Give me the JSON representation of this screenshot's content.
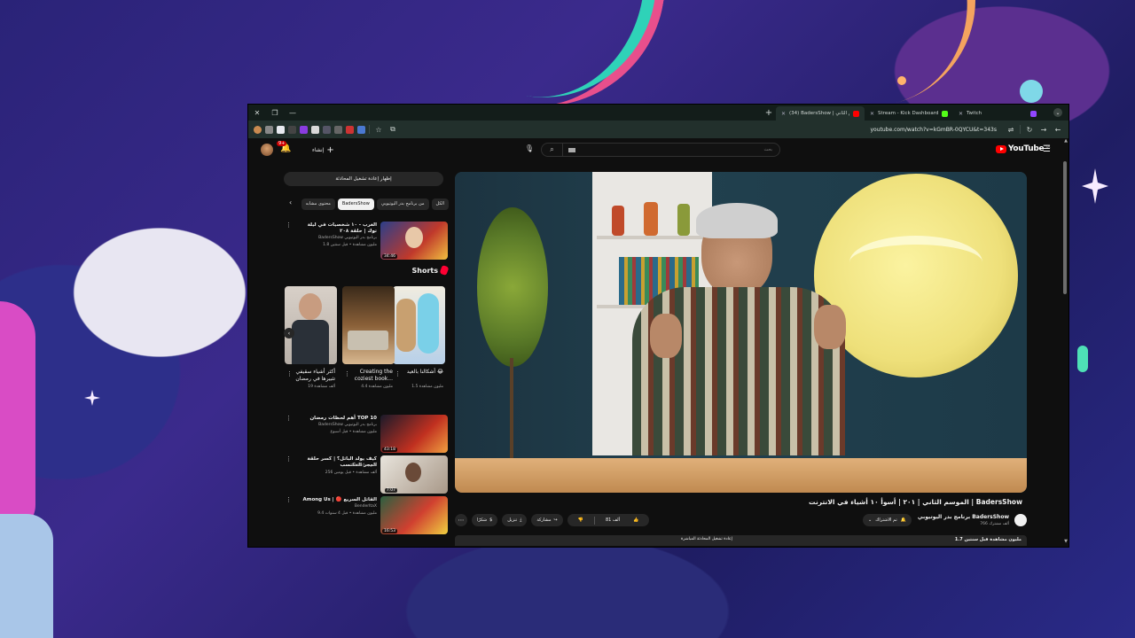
{
  "browser": {
    "tabs": [
      {
        "title": "(34) BadersShow | الموسم الثاني",
        "active": true,
        "favicon": "youtube",
        "color": "#ff0000"
      },
      {
        "title": "Stream - Kick Dashboard",
        "active": false,
        "favicon": "kick",
        "color": "#53fc18"
      },
      {
        "title": "Twitch",
        "active": false,
        "favicon": "twitch",
        "color": "#9146ff"
      }
    ],
    "url": "youtube.com/watch?v=kGmBR-0QYCU&t=343s"
  },
  "yt_header": {
    "notification_count": "9+",
    "create_label": "إنشاء",
    "search_placeholder": "بحث",
    "logo_text": "YouTube",
    "logo_region": "SA"
  },
  "sidebar": {
    "replay_chat_label": "إظهار إعادة تشغيل المحادثة",
    "chips": [
      {
        "label": "الكل",
        "selected": false
      },
      {
        "label": "من برنامج بدر اليوتيوبي",
        "selected": false
      },
      {
        "label": "BadersShow",
        "selected": true
      },
      {
        "label": "محتوى مشابه",
        "selected": false
      }
    ],
    "top_video": {
      "title": "الغرب - ١٠ شخصيات في ليلة توك | حلقة ٢٠٨",
      "channel": "BadersShow برنامج بدر اليوتيوبي",
      "meta": "1.8 مليون مشاهدة • قبل سنتين",
      "duration": "34:46"
    },
    "shorts_label": "Shorts",
    "shorts": [
      {
        "title": "أشكالنا بالعيد 😂",
        "views": "1.5 مليون مشاهدة"
      },
      {
        "title": "Creating the coziest book...",
        "views": "4.4 مليون مشاهدة"
      },
      {
        "title": "أكثر أشياء سقيفي تثبيرها في رمضان",
        "views": "19 ألف مشاهدة"
      }
    ],
    "videos": [
      {
        "title": "أهم لحظات رمضان TOP 10",
        "channel": "BadersShow برنامج بدر اليوتيوبي",
        "meta": "مليون مشاهدة • قبل أسبوع",
        "duration": "43:18"
      },
      {
        "title": "كيف يولد الباتل؟ | كسر حلقة المجر المكتسب",
        "channel": "Aswad - أسود",
        "meta": "256 ألف مشاهدة • قبل يومين",
        "duration": "7:07"
      },
      {
        "title": "Among Us | 🔴 القاتل السريع",
        "channel": "BenderItaX",
        "meta": "9.4 مليون مشاهدة • قبل 4 سنوات",
        "duration": "16:53"
      }
    ]
  },
  "video": {
    "title": "الموسم الثاني | ٢٠١ | أسوأ ١٠ أشياء في الانترنت | BadersShow",
    "channel_name": "برنامج بدر اليوتيوبي BadersShow",
    "subscribers": "766 ألف مشترك",
    "subscribed_label": "تم الاشتراك",
    "likes": "81 ألف",
    "share_label": "مشاركة",
    "download_label": "تنزيل",
    "thanks_label": "شكرًا",
    "views_meta": "1.7 مليون مشاهدة  قبل سنتين",
    "live_replay": "إعادة تشغيل المحادثة المباشرة"
  }
}
